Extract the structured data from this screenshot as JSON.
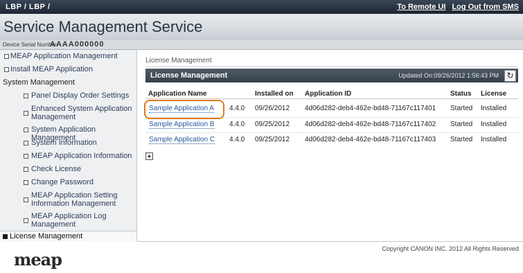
{
  "topbar": {
    "device": "LBP / LBP /",
    "remote_ui": "To Remote UI",
    "logout": "Log Out from SMS"
  },
  "header": {
    "title": "Service Management Service"
  },
  "serial": {
    "label": "Device Serial Number:",
    "value": "AAAA000000"
  },
  "sidebar": {
    "items": [
      {
        "label": "MEAP Application Management"
      },
      {
        "label": "Install MEAP Application"
      },
      {
        "label": "System Management"
      },
      {
        "label": "Panel Display Order Settings"
      },
      {
        "label": "Enhanced System Application Management"
      },
      {
        "label": "System Application Management"
      },
      {
        "label": "System Information"
      },
      {
        "label": "MEAP Application Information"
      },
      {
        "label": "Check License"
      },
      {
        "label": "Change Password"
      },
      {
        "label": "MEAP Application Setting Information Management"
      },
      {
        "label": "MEAP Application Log Management"
      },
      {
        "label": "License Management"
      }
    ]
  },
  "logo": "meap",
  "main": {
    "breadcrumb": "License Management",
    "section_title": "License Management",
    "updated": "Updated On:09/26/2012 1:56:43 PM",
    "refresh_icon": "refresh-icon",
    "columns": [
      "Application Name",
      "Installed on",
      "Application ID",
      "Status",
      "License"
    ],
    "rows": [
      {
        "name": "Sample Application A",
        "version": "4.4.0",
        "installed": "09/26/2012",
        "app_id": "4d06d282-deb4-462e-bd48-71167c117401",
        "status": "Started",
        "license": "Installed"
      },
      {
        "name": "Sample Application B",
        "version": "4.4.0",
        "installed": "09/25/2012",
        "app_id": "4d06d282-deb4-462e-bd48-71167c117402",
        "status": "Started",
        "license": "Installed"
      },
      {
        "name": "Sample Application C",
        "version": "4.4.0",
        "installed": "09/25/2012",
        "app_id": "4d06d282-deb4-462e-bd48-71167c117403",
        "status": "Started",
        "license": "Installed"
      }
    ]
  },
  "footer": {
    "copyright": "Copyright CANON INC. 2012 All Rights Reserved"
  },
  "colors": {
    "highlight": "#e07a1f",
    "link": "#27579c",
    "section_bar": "#3f4a55"
  }
}
